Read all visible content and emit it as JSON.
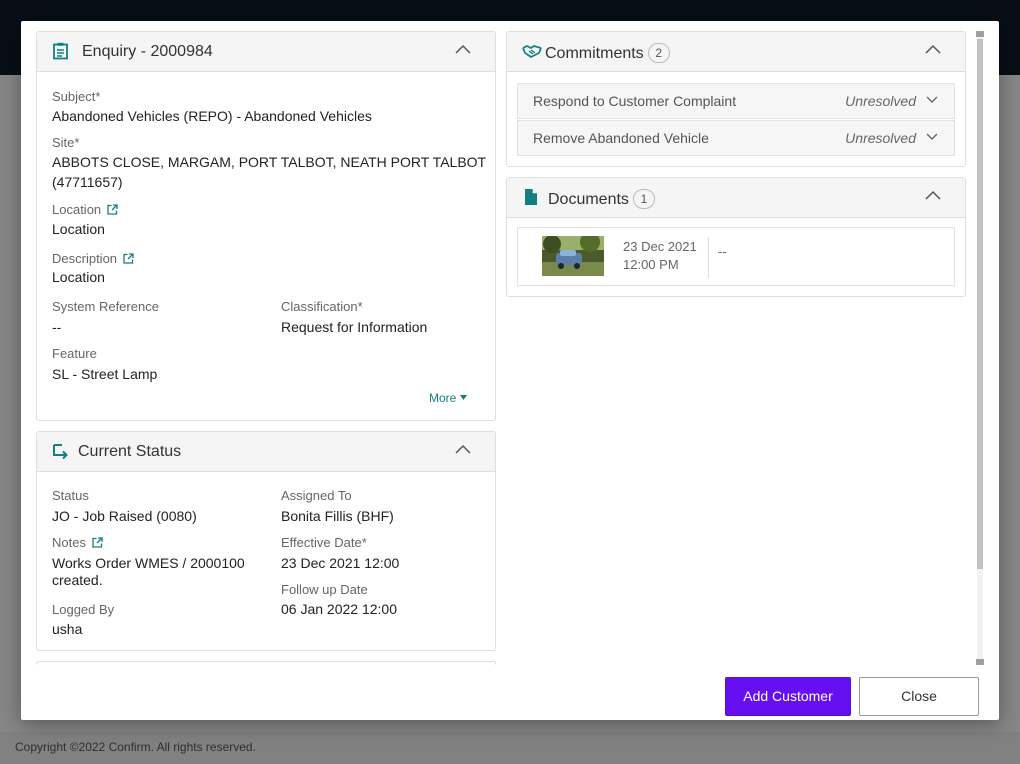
{
  "footer": {
    "copyright": "Copyright ©2022 Confirm. All rights reserved."
  },
  "colors": {
    "accent_teal": "#13807f",
    "primary_button": "#6610f2",
    "topbar": "#0d1b29"
  },
  "enquiry": {
    "title": "Enquiry - 2000984",
    "icon": "clipboard-icon",
    "fields": {
      "subject_label": "Subject*",
      "subject_value": "Abandoned Vehicles (REPO) - Abandoned Vehicles",
      "site_label": "Site*",
      "site_value_line1": "ABBOTS CLOSE, MARGAM, PORT TALBOT, NEATH PORT TALBOT",
      "site_value_line2": "(47711657)",
      "location_label": "Location",
      "location_value": "Location",
      "description_label": "Description",
      "description_value": "Location",
      "system_ref_label": "System Reference",
      "system_ref_value": "--",
      "classification_label": "Classification*",
      "classification_value": "Request for Information",
      "feature_label": "Feature",
      "feature_value": "SL - Street Lamp"
    },
    "more_label": "More"
  },
  "current_status": {
    "title": "Current Status",
    "icon": "status-arrow-icon",
    "status_label": "Status",
    "status_value": "JO - Job Raised (0080)",
    "assigned_label": "Assigned To",
    "assigned_value": "Bonita Fillis (BHF)",
    "notes_label": "Notes",
    "notes_value_line1": "Works Order WMES / 2000100",
    "notes_value_line2": "created.",
    "effective_label": "Effective Date*",
    "effective_value": "23 Dec 2021 12:00",
    "followup_label": "Follow up Date",
    "followup_value": "06 Jan 2022 12:00",
    "logged_label": "Logged By",
    "logged_value": "usha"
  },
  "commitments": {
    "title": "Commitments",
    "count": "2",
    "icon": "handshake-icon",
    "items": [
      {
        "name": "Respond to Customer Complaint",
        "status": "Unresolved"
      },
      {
        "name": "Remove Abandoned Vehicle",
        "status": "Unresolved"
      }
    ]
  },
  "documents": {
    "title": "Documents",
    "count": "1",
    "icon": "document-icon",
    "items": [
      {
        "date": "23 Dec 2021",
        "time": "12:00 PM",
        "description": "--"
      }
    ]
  },
  "buttons": {
    "add_customer": "Add Customer",
    "close": "Close"
  }
}
